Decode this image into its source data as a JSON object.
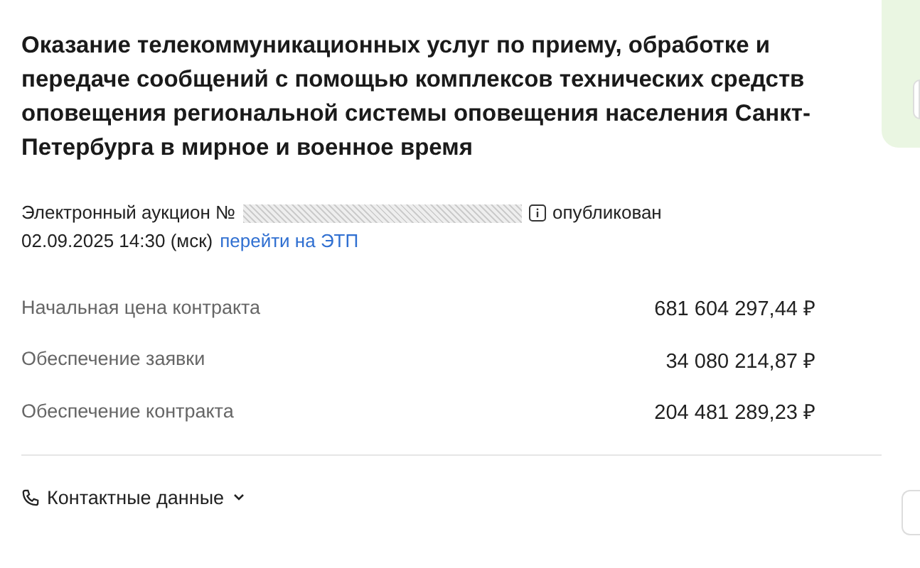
{
  "title": "Оказание телекоммуникационных услуг по приему, обработке и передаче сообщений с помощью комплексов технических средств оповещения региональной системы оповещения населения Санкт-Петербурга в мирное и военное время",
  "auction": {
    "prefix": "Электронный аукцион №",
    "status": "опубликован",
    "date": "02.09.2025 14:30 (мск)",
    "link": "перейти на ЭТП"
  },
  "prices": [
    {
      "label": "Начальная цена контракта",
      "value": "681 604 297,44 ₽"
    },
    {
      "label": "Обеспечение заявки",
      "value": "34 080 214,87 ₽"
    },
    {
      "label": "Обеспечение контракта",
      "value": "204 481 289,23 ₽"
    }
  ],
  "contacts": {
    "label": "Контактные данные",
    "expanded": false
  }
}
